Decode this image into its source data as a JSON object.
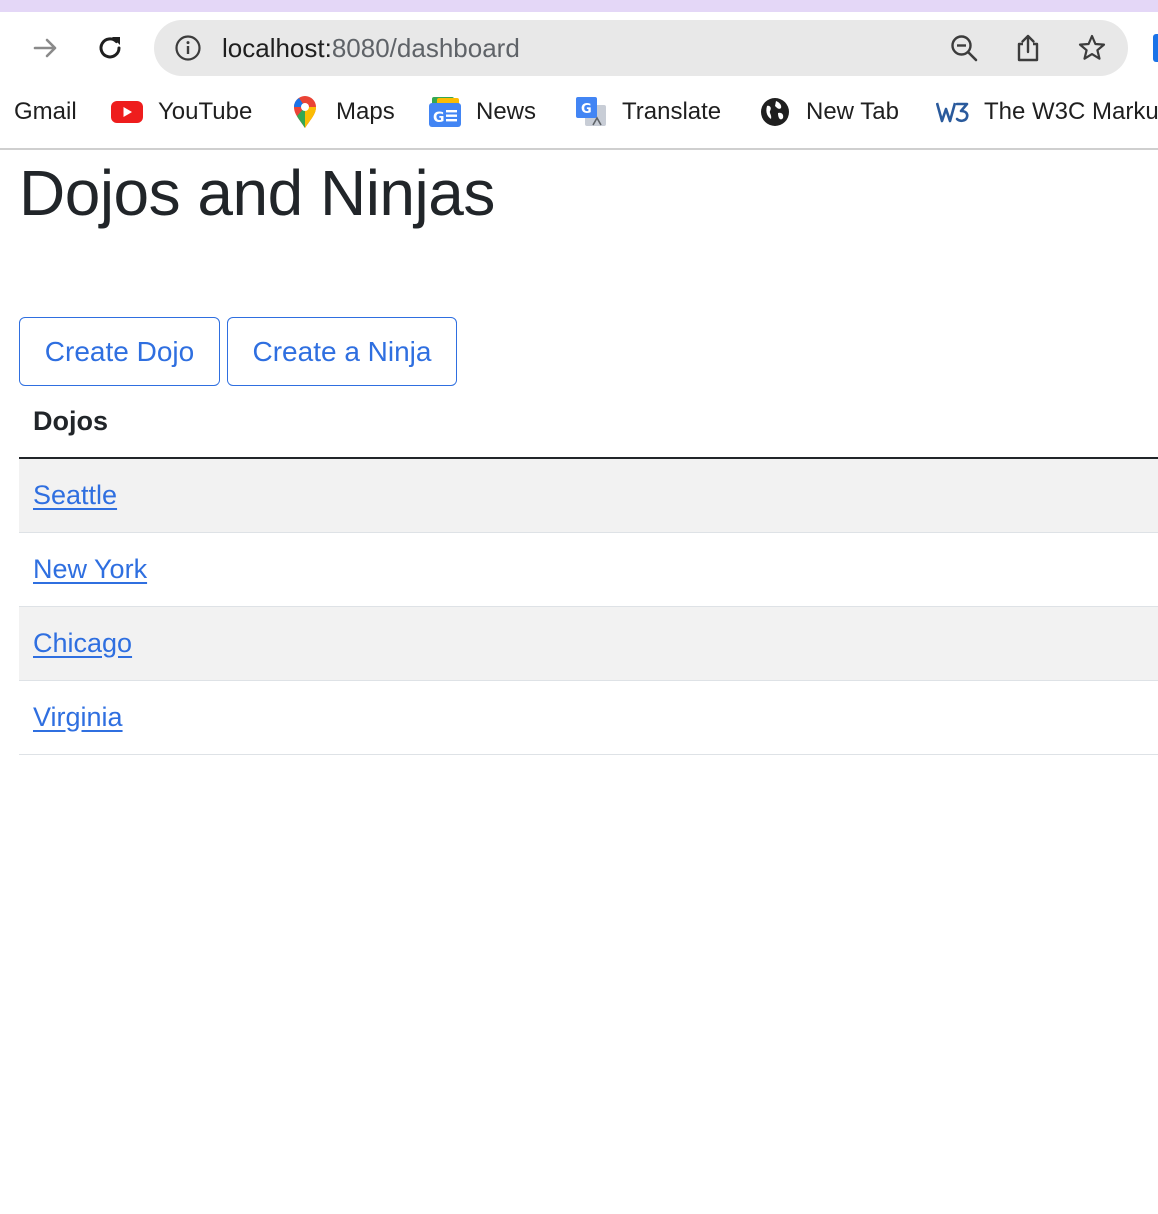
{
  "browser": {
    "url_host": "localhost:",
    "url_path": "8080/dashboard",
    "accent_color": "#1a73e8",
    "top_strip_color": "#e4d7f7"
  },
  "bookmarks": [
    {
      "label": "Gmail",
      "icon": "gmail-icon"
    },
    {
      "label": "YouTube",
      "icon": "youtube-icon"
    },
    {
      "label": "Maps",
      "icon": "maps-icon"
    },
    {
      "label": "News",
      "icon": "news-icon"
    },
    {
      "label": "Translate",
      "icon": "translate-icon"
    },
    {
      "label": "New Tab",
      "icon": "globe-icon"
    },
    {
      "label": "The W3C Marku",
      "icon": "w3c-icon"
    }
  ],
  "page": {
    "title": "Dojos and Ninjas",
    "create_dojo_label": "Create Dojo",
    "create_ninja_label": "Create a Ninja",
    "table": {
      "header": "Dojos",
      "rows": [
        "Seattle",
        "New York",
        "Chicago",
        "Virginia"
      ]
    },
    "link_color": "#2f6fe0"
  }
}
